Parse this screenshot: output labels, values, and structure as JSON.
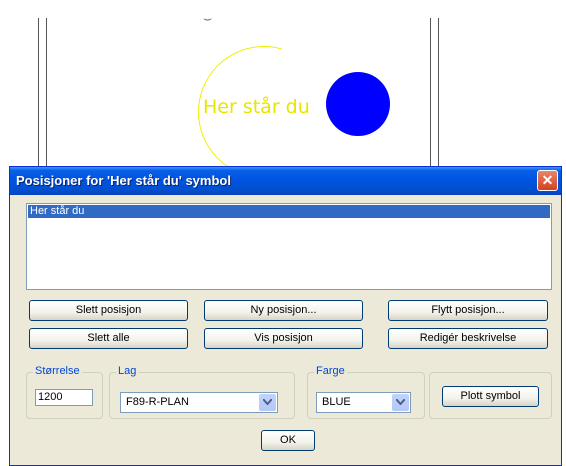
{
  "canvas": {
    "label_text": "Her står du"
  },
  "dialog": {
    "title": "Posisjoner for 'Her står du' symbol",
    "close_glyph": "✕",
    "list_items": [
      "Her står du"
    ],
    "buttons": {
      "delete_position": "Slett posisjon",
      "new_position": "Ny posisjon...",
      "move_position": "Flytt posisjon...",
      "delete_all": "Slett alle",
      "show_position": "Vis posisjon",
      "edit_description": "Redigér beskrivelse",
      "plot_symbol": "Plott symbol",
      "ok": "OK"
    },
    "size_group": {
      "label": "Størrelse",
      "value": "1200"
    },
    "layer_group": {
      "label": "Lag",
      "value": "F89-R-PLAN"
    },
    "color_group": {
      "label": "Farge",
      "value": "BLUE"
    }
  },
  "colors": {
    "title_bar": "#0054e3",
    "selection": "#316ac5",
    "group_label": "#0046d5",
    "blue_symbol": "#0000ff",
    "yellow_symbol": "#f0f000"
  }
}
